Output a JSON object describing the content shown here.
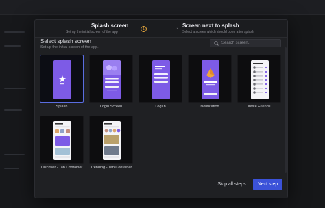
{
  "stepper": {
    "steps": [
      {
        "title": "Splash screen",
        "subtitle": "Set up the initial screen of the app",
        "number": "1"
      },
      {
        "title": "Screen next to splash",
        "subtitle": "Select a screen which should open after splash",
        "number": "2"
      }
    ]
  },
  "section": {
    "title": "Select splash screen",
    "subtitle": "Set up the initial screen of the app."
  },
  "search": {
    "placeholder": "Search screen.."
  },
  "screens": [
    {
      "label": "Splash",
      "selected": true
    },
    {
      "label": "Login Screen",
      "selected": false
    },
    {
      "label": "Log In",
      "selected": false
    },
    {
      "label": "Notification",
      "selected": false
    },
    {
      "label": "Invite Friends",
      "selected": false
    },
    {
      "label": "Discover - Tab Container",
      "selected": false
    },
    {
      "label": "Trending - Tab Container",
      "selected": false
    }
  ],
  "footer": {
    "skip_label": "Skip all steps",
    "next_label": "Next step"
  },
  "colors": {
    "accent": "#3b52d9",
    "step_active": "#e6a63c",
    "preview_purple": "#7d5be6"
  },
  "icons": {
    "search": "search-icon",
    "splash_logo": "star-logo-icon"
  }
}
